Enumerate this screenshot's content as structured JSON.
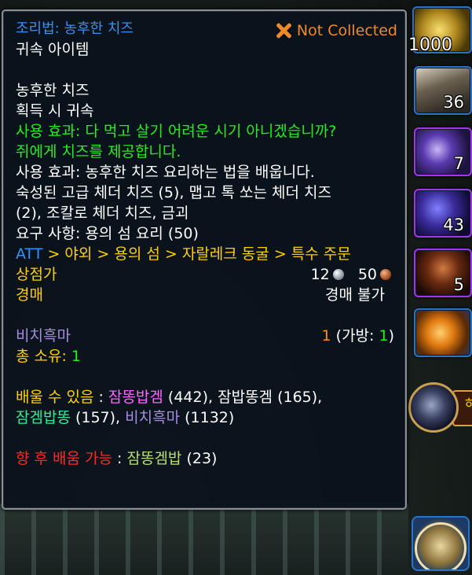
{
  "tooltip": {
    "header": "조리법: 농후한 치즈",
    "binding_top": "귀속 아이템",
    "not_collected": "Not Collected",
    "item_name": "농후한 치즈",
    "bind_on_pickup": "획득 시 귀속",
    "use_flavor_1": "사용 효과: 다 먹고 살기 어려운 시기 아니겠습니까?",
    "use_flavor_2": "쥐에게 치즈를 제공합니다.",
    "use_learn": "사용 효과: 농후한 치즈 요리하는 법을 배웁니다.",
    "reagents_1": "숙성된 고급 체더 치즈 (5), 맵고 톡 쏘는 체더 치즈",
    "reagents_2": "(2), 조칼로 체더 치즈, 금괴",
    "requires": "요구 사항: 용의 섬 요리 (50)",
    "path": {
      "prefix": "ATT",
      "sep": " > ",
      "items": [
        "야외",
        "용의 섬",
        "자랄레크 동굴",
        "특수 주문"
      ]
    },
    "vendor_price_label": "상점가",
    "vendor_silver": "12",
    "vendor_copper": "50",
    "auction_label": "경매",
    "auction_value": "경매 불가",
    "character_name": "비치흑마",
    "character_count": "1",
    "character_bag_label": "(가방: ",
    "character_bag_count": "1",
    "character_bag_close": ")",
    "total_label": "총 소유: ",
    "total_value": "1",
    "learnable_label": "배울 수 있음",
    "learnable_colon": " : ",
    "learnable_1_name": "잠똥밥겜",
    "learnable_1_level": " (442), ",
    "learnable_2_name": "잠밥똥겜 (165),",
    "learnable_3_name": "잠겜밥똥",
    "learnable_3_level": " (157), ",
    "learnable_4_name": "비치흑마",
    "learnable_4_level": " (1132)",
    "future_label": "향 후 배움 가능",
    "future_colon": " : ",
    "future_name": "잠똥겜밥",
    "future_level": " (23)"
  },
  "bags": [
    {
      "name": "gold-ore",
      "count": "1000"
    },
    {
      "name": "potion-bottle",
      "count": "36"
    },
    {
      "name": "purple-gem",
      "count": "7"
    },
    {
      "name": "arcane-dust",
      "count": "43"
    },
    {
      "name": "shadow-figure",
      "count": "5"
    },
    {
      "name": "orange-crystal",
      "count": ""
    }
  ],
  "side_widget_label": "하",
  "colors": {
    "title_blue": "#3a8ff0",
    "use_green": "#22ee22",
    "gold": "#ffd100",
    "not_collected": "#f08a28",
    "character": "#a58dde",
    "alt_pink": "#ff66ff",
    "alt_cyan": "#33ee99",
    "future_red": "#ff2828"
  }
}
